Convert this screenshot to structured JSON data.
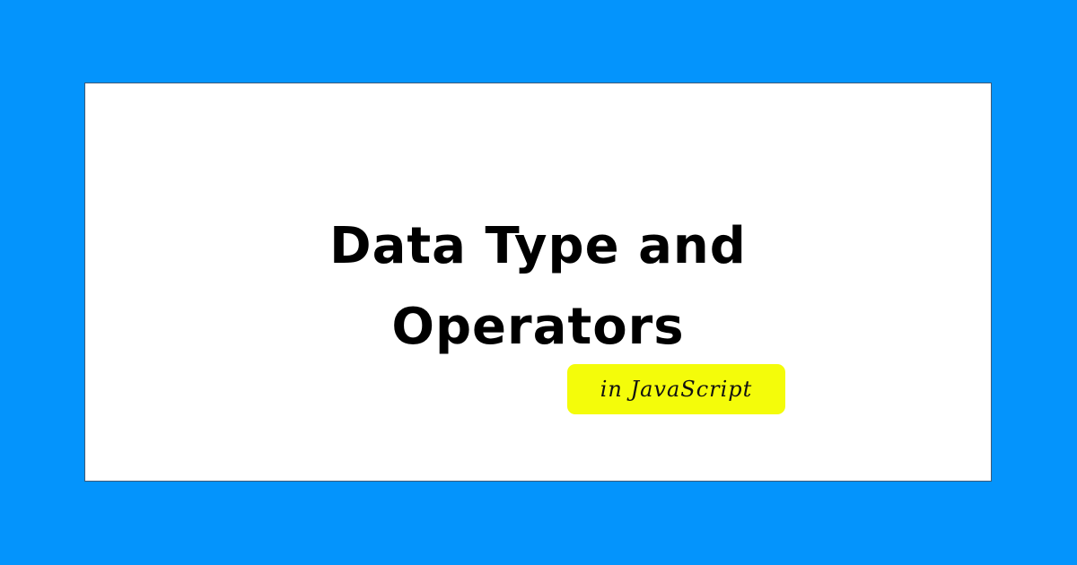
{
  "colors": {
    "background": "#0494fc",
    "card": "#ffffff",
    "title_text": "#000000",
    "badge": "#f4fc0a"
  },
  "card": {
    "title_line1": "Data Type and",
    "title_line2": "Operators",
    "badge_text": "in JavaScript"
  }
}
